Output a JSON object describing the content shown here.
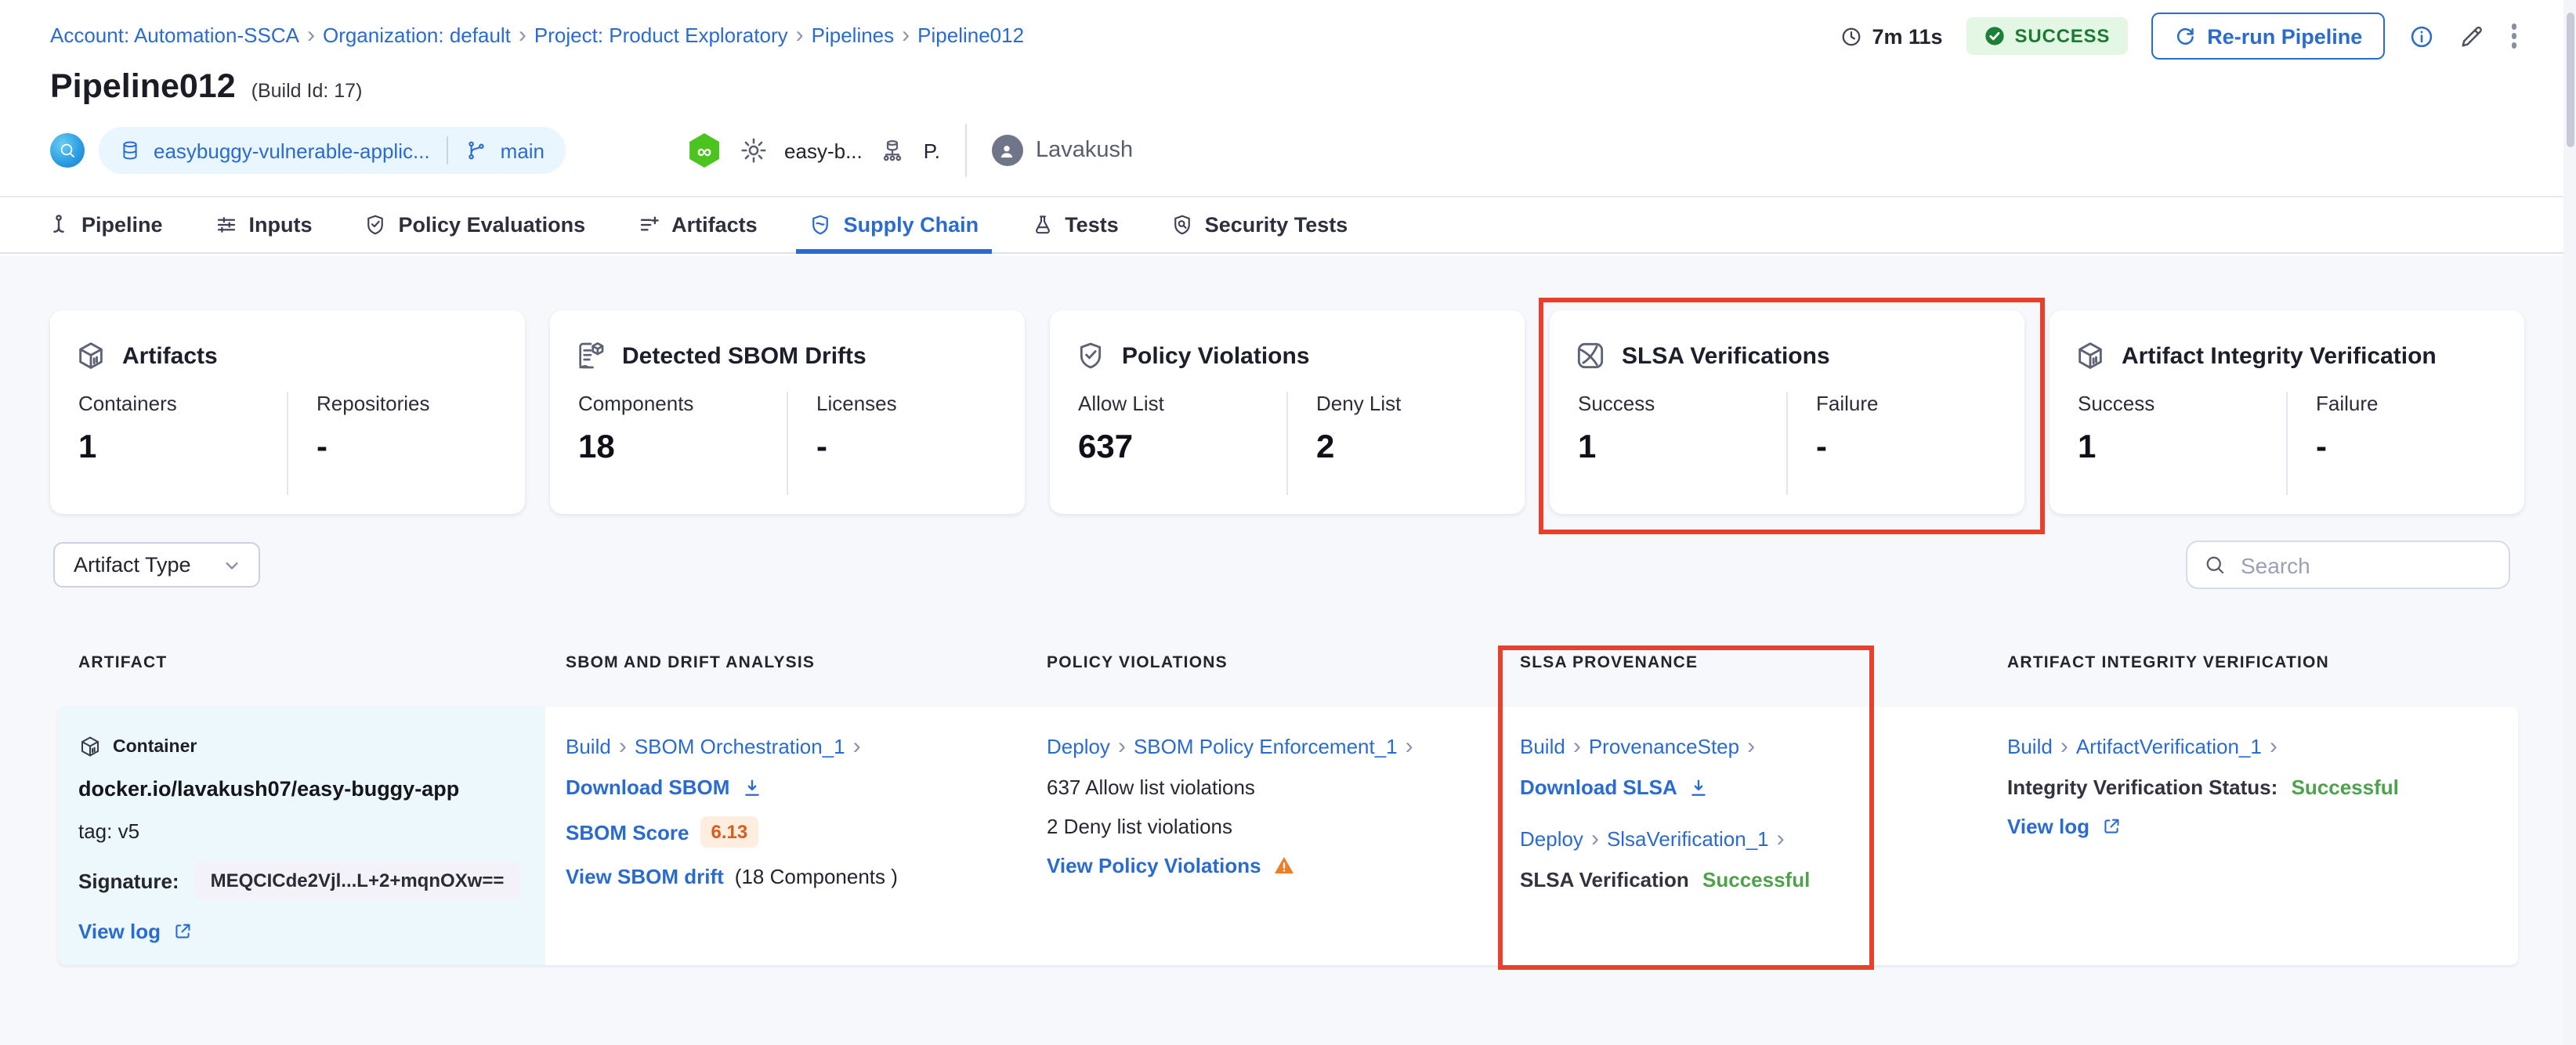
{
  "breadcrumb": {
    "items": [
      {
        "label": "Account: Automation-SSCA"
      },
      {
        "label": "Organization: default"
      },
      {
        "label": "Project: Product Exploratory"
      },
      {
        "label": "Pipelines"
      },
      {
        "label": "Pipeline012"
      }
    ]
  },
  "topbar": {
    "duration": "7m 11s",
    "status": "SUCCESS",
    "rerun_label": "Re-run Pipeline"
  },
  "header": {
    "title": "Pipeline012",
    "build_id": "(Build Id: 17)",
    "repo": "easybuggy-vulnerable-applic...",
    "branch": "main",
    "trigger_name": "easy-b...",
    "trigger_short": "P.",
    "executed_by": "Lavakush"
  },
  "tabs": [
    {
      "label": "Pipeline",
      "icon": "pipeline-icon",
      "active": false
    },
    {
      "label": "Inputs",
      "icon": "sliders-icon",
      "active": false
    },
    {
      "label": "Policy Evaluations",
      "icon": "shield-check-icon",
      "active": false
    },
    {
      "label": "Artifacts",
      "icon": "list-plus-icon",
      "active": false
    },
    {
      "label": "Supply Chain",
      "icon": "shield-icon",
      "active": true
    },
    {
      "label": "Tests",
      "icon": "flask-icon",
      "active": false
    },
    {
      "label": "Security Tests",
      "icon": "shield-search-icon",
      "active": false
    }
  ],
  "summary_cards": [
    {
      "title": "Artifacts",
      "icon": "cube-icon",
      "highlighted": false,
      "stats": [
        {
          "label": "Containers",
          "value": "1"
        },
        {
          "label": "Repositories",
          "value": "-"
        }
      ]
    },
    {
      "title": "Detected SBOM Drifts",
      "icon": "sbom-document-icon",
      "highlighted": false,
      "stats": [
        {
          "label": "Components",
          "value": "18"
        },
        {
          "label": "Licenses",
          "value": "-"
        }
      ]
    },
    {
      "title": "Policy Violations",
      "icon": "shield-check-icon",
      "highlighted": false,
      "stats": [
        {
          "label": "Allow List",
          "value": "637"
        },
        {
          "label": "Deny List",
          "value": "2"
        }
      ]
    },
    {
      "title": "SLSA Verifications",
      "icon": "slsa-icon",
      "highlighted": true,
      "stats": [
        {
          "label": "Success",
          "value": "1"
        },
        {
          "label": "Failure",
          "value": "-"
        }
      ]
    },
    {
      "title": "Artifact Integrity Verification",
      "icon": "cube-icon",
      "highlighted": false,
      "stats": [
        {
          "label": "Success",
          "value": "1"
        },
        {
          "label": "Failure",
          "value": "-"
        }
      ]
    }
  ],
  "filters": {
    "artifact_type_label": "Artifact Type",
    "search_placeholder": "Search"
  },
  "table": {
    "headers": [
      "ARTIFACT",
      "SBOM AND DRIFT ANALYSIS",
      "POLICY VIOLATIONS",
      "SLSA PROVENANCE",
      "ARTIFACT INTEGRITY VERIFICATION"
    ],
    "row": {
      "artifact": {
        "type_label": "Container",
        "image": "docker.io/lavakush07/easy-buggy-app",
        "tag": "tag: v5",
        "signature_label": "Signature:",
        "signature_value": "MEQCICde2Vjl...L+2+mqnOXw==",
        "view_log_label": "View log"
      },
      "sbom": {
        "stage": "Build",
        "step": "SBOM Orchestration_1",
        "download_label": "Download SBOM",
        "score_label": "SBOM Score",
        "score_value": "6.13",
        "drift_label": "View SBOM drift",
        "drift_count": "(18 Components )"
      },
      "policy": {
        "stage": "Deploy",
        "step": "SBOM Policy Enforcement_1",
        "allow_text": "637 Allow list violations",
        "deny_text": "2 Deny list violations",
        "view_label": "View Policy Violations"
      },
      "slsa": {
        "stage1": "Build",
        "step1": "ProvenanceStep",
        "download_label": "Download SLSA",
        "stage2": "Deploy",
        "step2": "SlsaVerification_1",
        "status_label": "SLSA Verification",
        "status_value": "Successful"
      },
      "integrity": {
        "stage": "Build",
        "step": "ArtifactVerification_1",
        "status_label": "Integrity Verification Status:",
        "status_value": "Successful",
        "view_log_label": "View log"
      }
    }
  },
  "colors": {
    "link_blue": "#2a6bd2",
    "success_green": "#4da24b",
    "annotation_red": "#e8402c",
    "badge_green_text": "#1a7c33",
    "warning_orange": "#ee7d28",
    "score_orange": "#d95b1e"
  }
}
